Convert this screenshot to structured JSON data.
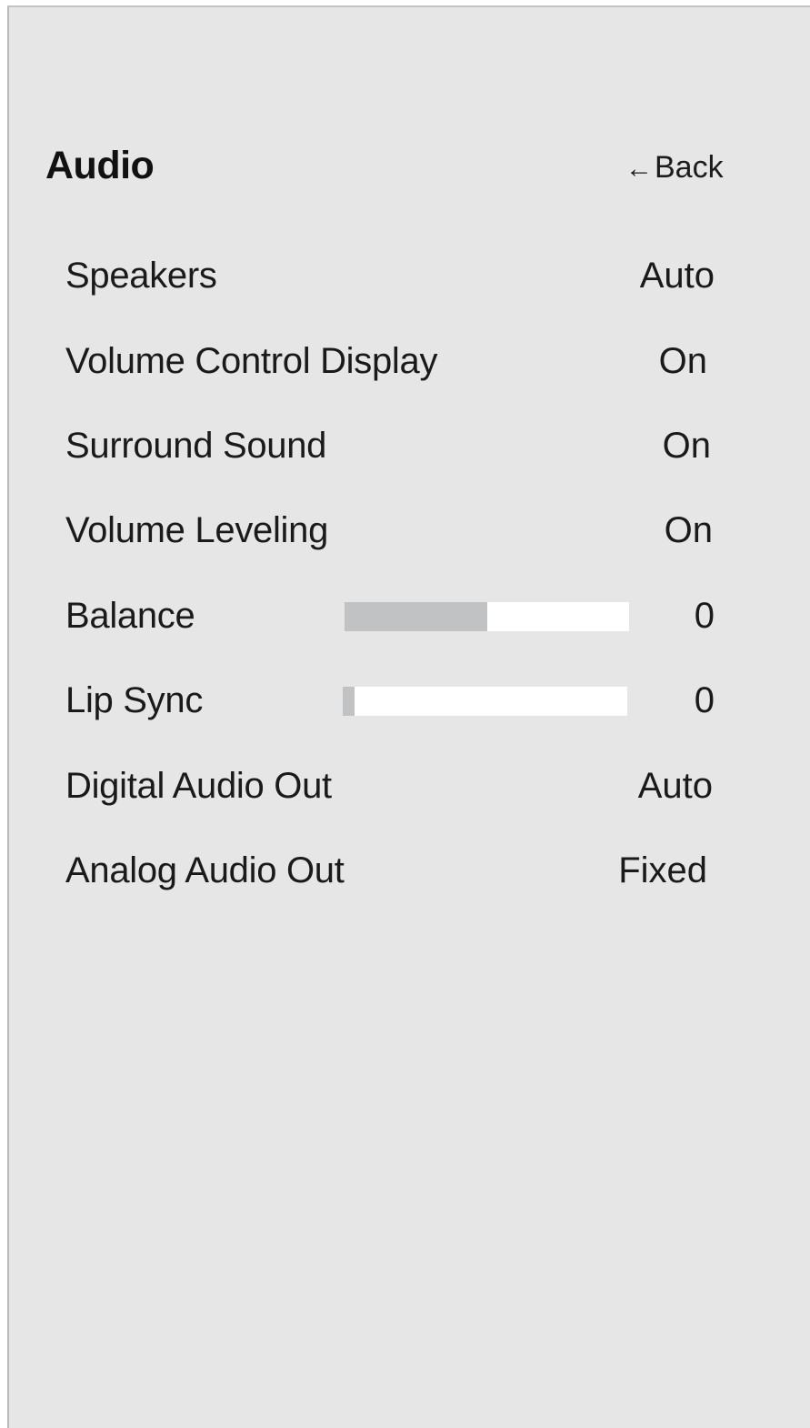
{
  "menu": {
    "title": "Audio",
    "back_arrow": "←",
    "back_label": "Back"
  },
  "items": [
    {
      "label": "Speakers",
      "value": "Auto"
    },
    {
      "label": "Volume Control Display",
      "value": "On"
    },
    {
      "label": "Surround Sound",
      "value": "On"
    },
    {
      "label": "Volume Leveling",
      "value": "On"
    },
    {
      "label": "Balance",
      "value": "0",
      "slider_level": 0.5
    },
    {
      "label": "Lip Sync",
      "value": "0",
      "slider_level": 0.04
    },
    {
      "label": "Digital Audio Out",
      "value": "Auto"
    },
    {
      "label": "Analog Audio Out",
      "value": "Fixed"
    }
  ],
  "colors": {
    "panel_background": "#e6e6e6",
    "slider_track": "#ffffff",
    "slider_fill": "#c1c2c4",
    "text": "#1a1a1a"
  }
}
